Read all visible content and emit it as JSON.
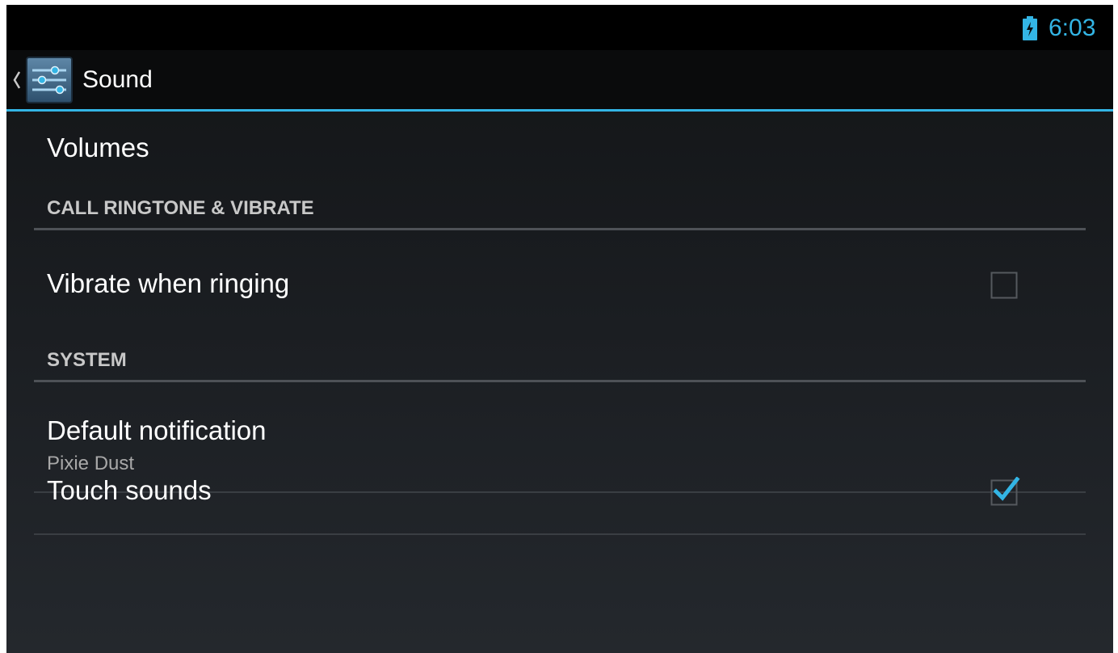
{
  "status_bar": {
    "time": "6:03",
    "battery_icon": "battery-charging-icon"
  },
  "action_bar": {
    "up_icon": "chevron-left-icon",
    "app_icon": "settings-sliders-icon",
    "title": "Sound"
  },
  "list": {
    "volumes": {
      "title": "Volumes"
    },
    "section_call": {
      "header": "CALL RINGTONE & VIBRATE"
    },
    "vibrate": {
      "title": "Vibrate when ringing",
      "checked": false
    },
    "section_system": {
      "header": "SYSTEM"
    },
    "default_notification": {
      "title": "Default notification",
      "summary": "Pixie Dust"
    },
    "touch_sounds": {
      "title": "Touch sounds",
      "checked": true
    }
  },
  "colors": {
    "accent": "#33b5e5",
    "background": "#1b1e22",
    "text_primary": "#ffffff",
    "text_secondary": "#a8a8a8"
  }
}
